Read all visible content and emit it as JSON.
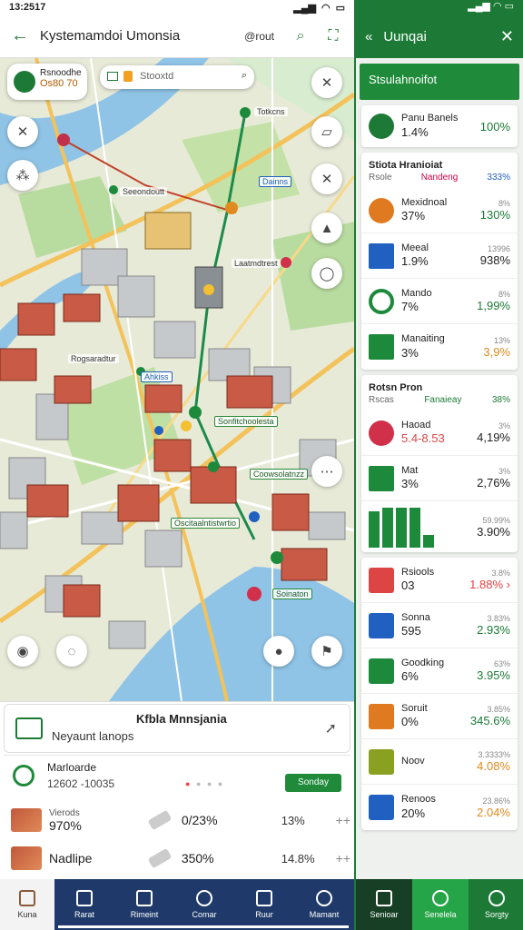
{
  "status": {
    "time": "13:2517",
    "signal": "▂▄▆",
    "wifi": "◠",
    "battery": "▭"
  },
  "appbar": {
    "title": "Kystemamdoi Umonsia",
    "tag": "@rout"
  },
  "map": {
    "chip_title": "Rsnoodhe",
    "chip_sub": "Os80 70",
    "search_placeholder": "Stooxtd",
    "labels": [
      "Totkcns",
      "Seeondoutt",
      "Dainns",
      "Laatmdtrest",
      "Rogsaradtur",
      "Ahkiss",
      "Sonfitchoolesta",
      "Coowsolatnzz",
      "Oscitaalntistwrtio",
      "Soinaton"
    ]
  },
  "sheet": {
    "title": "Kfbla Mnnsjania",
    "subtitle": "Neyaunt lanops",
    "contact_name": "Marloarde",
    "contact_phone": "12602 -10035",
    "action_label": "Sonday",
    "row_a": {
      "label_top": "Vierods",
      "v1": "970%",
      "v2": "0/23%",
      "v3": "13%",
      "v4": "++"
    },
    "row_b": {
      "label": "Nadlipe",
      "v2": "350%",
      "v3": "14.8%",
      "v4": "++"
    }
  },
  "nav_left": [
    "Kuna",
    "Rarat",
    "Rimeint",
    "Comar",
    "Ruur",
    "Mamant"
  ],
  "right": {
    "title": "Uunqai",
    "subtitle": "Stsulahnoifot",
    "top_item": {
      "name": "Panu Banels",
      "pct": "1.4%",
      "val": "100%"
    },
    "group1": {
      "title": "Stiota Hranioiat",
      "hdr_left": "Rsole",
      "hdr_mid": "Nandeng",
      "hdr_right": "333%",
      "items": [
        {
          "name": "Mexidnoal",
          "pct": "37%",
          "small": "8%",
          "val": "130%",
          "color": "#e07a20"
        },
        {
          "name": "Meeal",
          "pct": "1.9%",
          "small": "13996",
          "val": "938%",
          "color": "#2060c0"
        },
        {
          "name": "Mando",
          "pct": "7%",
          "small": "8%",
          "val": "1,99%",
          "color": "#1c8a3a"
        },
        {
          "name": "Manaiting",
          "pct": "3%",
          "small": "13%",
          "val": "3,9%",
          "color": "#1c8a3a"
        }
      ]
    },
    "group2": {
      "title": "Rotsn Pron",
      "hdr_left": "Rscas",
      "hdr_mid": "Fanaieay",
      "hdr_right": "38%",
      "items": [
        {
          "name": "Haoad",
          "pct": "5.4-8.53",
          "small": "3%",
          "val": "4,19%",
          "color": "#d0304a"
        },
        {
          "name": "Mat",
          "pct": "3%",
          "small": "3%",
          "val": "2,76%",
          "color": "#1c8a3a"
        },
        {
          "name": "",
          "pct": "",
          "small": "59.99%",
          "val": "3.90%",
          "color": "#1c8a3a"
        }
      ]
    },
    "group3": {
      "items": [
        {
          "name": "Rsiools",
          "pct": "03",
          "small": "3.8%",
          "val": "1.88%",
          "color": "#d44"
        },
        {
          "name": "Sonna",
          "pct": "595",
          "small": "3.83%",
          "val": "2.93%",
          "color": "#1c8a3a"
        },
        {
          "name": "Goodking",
          "pct": "6%",
          "small": "63%",
          "val": "3.95%",
          "color": "#1c8a3a"
        },
        {
          "name": "Soruit",
          "pct": "0%",
          "small": "3.85%",
          "val": "345.6%",
          "color": "#1c8a3a"
        },
        {
          "name": "Noov",
          "pct": "",
          "small": "3.3333%",
          "val": "4.08%",
          "color": "#e07a20"
        },
        {
          "name": "Renoos",
          "pct": "20%",
          "small": "23.86%",
          "val": "2.04%",
          "color": "#e07a20"
        }
      ]
    }
  },
  "nav_right": [
    "Senioar",
    "Senelela",
    "Sorgty"
  ]
}
